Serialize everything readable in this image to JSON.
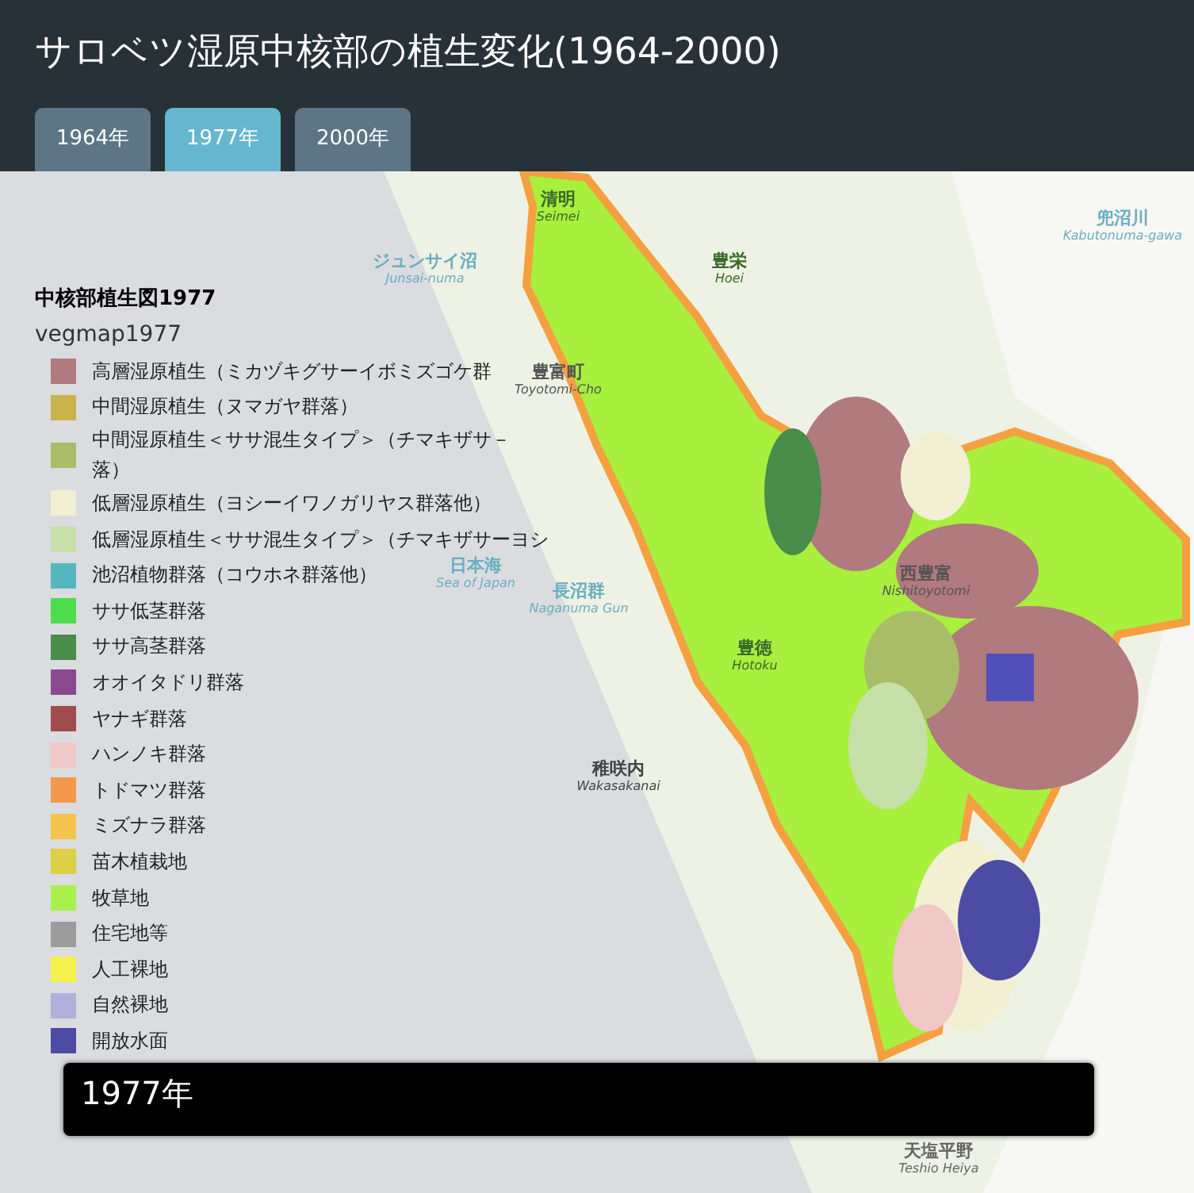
{
  "header": {
    "title": "サロベツ湿原中核部の植生変化(1964-2000)"
  },
  "tabs": [
    {
      "label": "1964年",
      "selected": false
    },
    {
      "label": "1977年",
      "selected": true
    },
    {
      "label": "2000年",
      "selected": false
    }
  ],
  "legend": {
    "title": "中核部植生図1977",
    "layer": "vegmap1977",
    "items": [
      {
        "lines": [
          "高層湿原植生（ミカヅキグサーイボミズゴケ群"
        ],
        "color": "#b07a7e"
      },
      {
        "lines": [
          "中間湿原植生（ヌマガヤ群落）"
        ],
        "color": "#c8b44a"
      },
      {
        "lines": [
          "中間湿原植生＜ササ混生タイプ＞（チマキザサ－",
          "落）"
        ],
        "color": "#a9bd68"
      },
      {
        "lines": [
          "低層湿原植生（ヨシーイワノガリヤス群落他）"
        ],
        "color": "#f2efd2"
      },
      {
        "lines": [
          "低層湿原植生＜ササ混生タイプ＞（チマキザサーヨシ"
        ],
        "color": "#c7dfa8"
      },
      {
        "lines": [
          "池沼植物群落（コウホネ群落他）"
        ],
        "color": "#55b8c0"
      },
      {
        "lines": [
          "ササ低茎群落"
        ],
        "color": "#4cdc4c"
      },
      {
        "lines": [
          "ササ高茎群落"
        ],
        "color": "#4a8c4a"
      },
      {
        "lines": [
          "オオイタドリ群落"
        ],
        "color": "#8a4a90"
      },
      {
        "lines": [
          "ヤナギ群落"
        ],
        "color": "#a04c4c"
      },
      {
        "lines": [
          "ハンノキ群落"
        ],
        "color": "#f0c8c8"
      },
      {
        "lines": [
          "トドマツ群落"
        ],
        "color": "#f4984c"
      },
      {
        "lines": [
          "ミズナラ群落"
        ],
        "color": "#f4c44c"
      },
      {
        "lines": [
          "苗木植栽地"
        ],
        "color": "#dcd048"
      },
      {
        "lines": [
          "牧草地"
        ],
        "color": "#aaf04c"
      },
      {
        "lines": [
          "住宅地等"
        ],
        "color": "#9c9c9c"
      },
      {
        "lines": [
          "人工裸地"
        ],
        "color": "#f4f04c"
      },
      {
        "lines": [
          "自然裸地"
        ],
        "color": "#b0b0dc"
      },
      {
        "lines": [
          "開放水面"
        ],
        "color": "#4c4ca4"
      }
    ]
  },
  "map": {
    "labels": [
      {
        "name": "清明",
        "romaji": "Seimei"
      },
      {
        "name": "ジュンサイ沼",
        "romaji": "Junsai-numa"
      },
      {
        "name": "豊栄",
        "romaji": "Hoei"
      },
      {
        "name": "兜沼川",
        "romaji": "Kabutonuma-gawa"
      },
      {
        "name": "豊富町",
        "romaji": "Toyotomi-Cho"
      },
      {
        "name": "日本海",
        "romaji": "Sea of Japan"
      },
      {
        "name": "長沼群",
        "romaji": "Naganuma Gun"
      },
      {
        "name": "西豊富",
        "romaji": "Nishitoyotomi"
      },
      {
        "name": "豊徳",
        "romaji": "Hotoku"
      },
      {
        "name": "稚咲内",
        "romaji": "Wakasakanai"
      },
      {
        "name": "天塩平野",
        "romaji": "Teshio Heiya"
      }
    ]
  },
  "caption": {
    "text": "1977年"
  }
}
